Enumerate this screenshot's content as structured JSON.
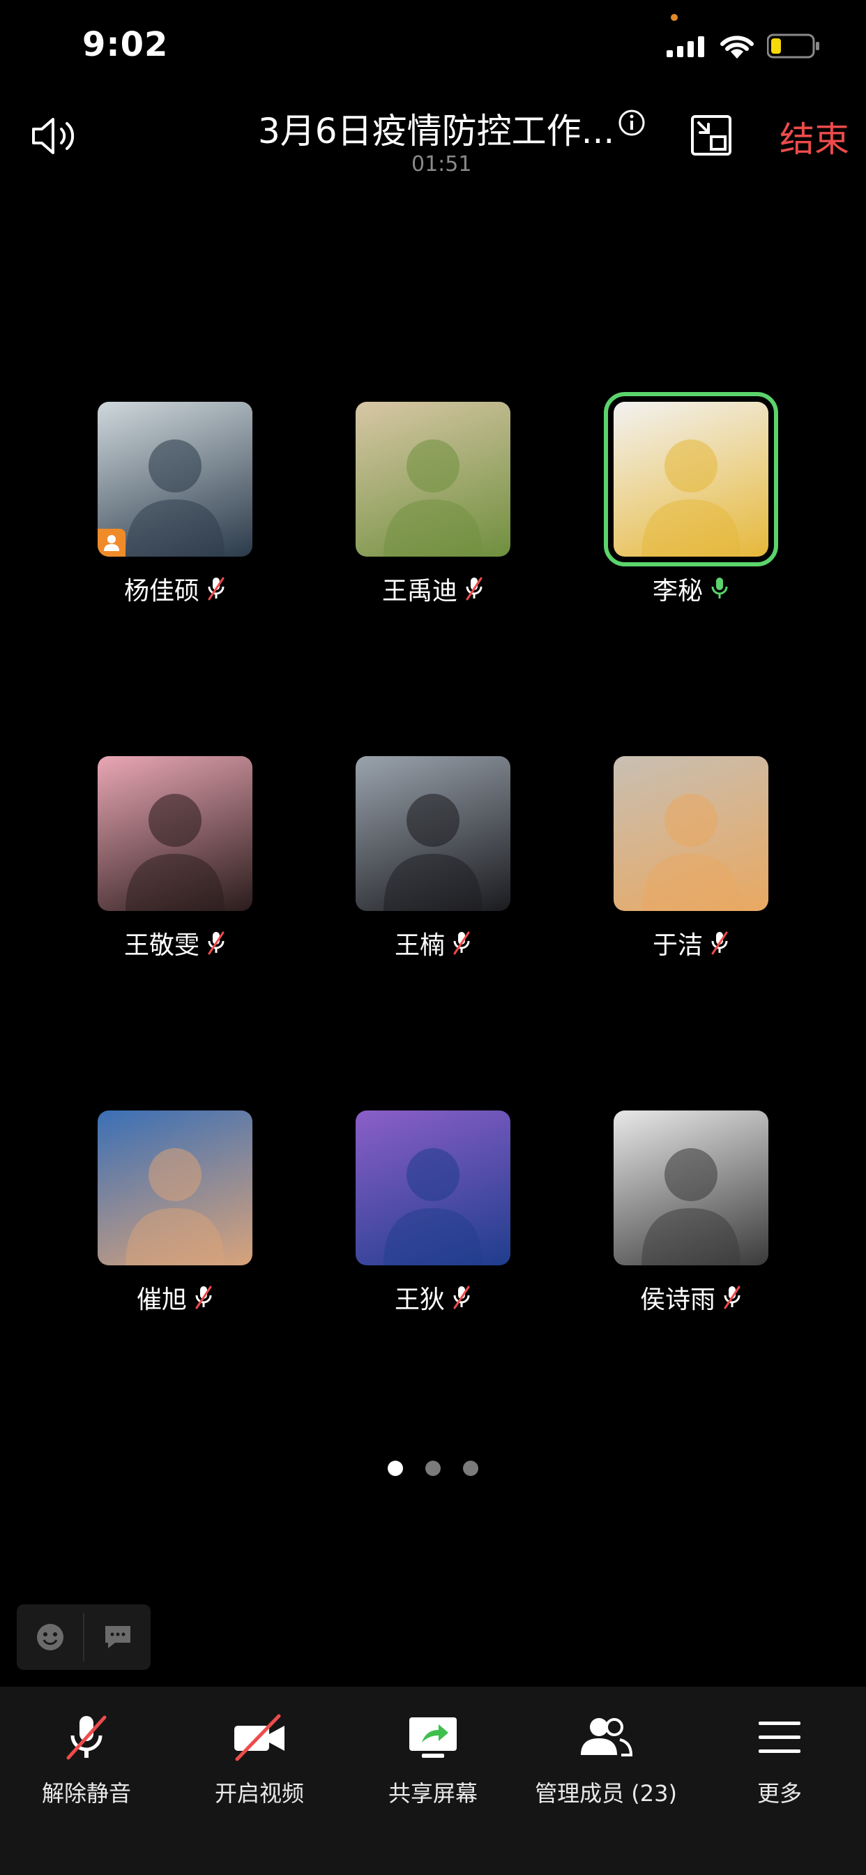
{
  "status_bar": {
    "time": "9:02"
  },
  "header": {
    "title": "3月6日疫情防控工作...",
    "elapsed": "01:51",
    "end_label": "结束"
  },
  "participants": [
    {
      "name": "杨佳硕",
      "mic": "muted",
      "host": true,
      "colors": [
        "#cfd8dc",
        "#2b3a4a"
      ]
    },
    {
      "name": "王禹迪",
      "mic": "muted",
      "host": false,
      "colors": [
        "#d8c7a6",
        "#6f8f3e"
      ]
    },
    {
      "name": "李秘",
      "mic": "active",
      "host": false,
      "speaking": true,
      "colors": [
        "#f2f2f2",
        "#e6b83a"
      ]
    },
    {
      "name": "王敬雯",
      "mic": "muted",
      "host": false,
      "colors": [
        "#e9a7b4",
        "#2a1c1c"
      ]
    },
    {
      "name": "王楠",
      "mic": "muted",
      "host": false,
      "colors": [
        "#9aa3ad",
        "#1b1b1f"
      ]
    },
    {
      "name": "于洁",
      "mic": "muted",
      "host": false,
      "colors": [
        "#c8bfb3",
        "#e9a861"
      ]
    },
    {
      "name": "催旭",
      "mic": "muted",
      "host": false,
      "colors": [
        "#3a6fb6",
        "#d9a37a"
      ]
    },
    {
      "name": "王狄",
      "mic": "muted",
      "host": false,
      "colors": [
        "#8b5fc8",
        "#1f3d8c"
      ]
    },
    {
      "name": "侯诗雨",
      "mic": "muted",
      "host": false,
      "colors": [
        "#e8e8e8",
        "#3a3a3a"
      ]
    }
  ],
  "pagination": {
    "pages": 3,
    "current": 1
  },
  "quick_bar": {
    "icons": [
      "emoji-icon",
      "chat-icon"
    ]
  },
  "toolbar": {
    "unmute_label": "解除静音",
    "video_label": "开启视频",
    "share_label": "共享屏幕",
    "members_label": "管理成员 (23)",
    "more_label": "更多"
  },
  "colors": {
    "accent_end": "#ee4b4b",
    "speaking_green": "#5bd46b",
    "share_green": "#3fbf4b"
  }
}
